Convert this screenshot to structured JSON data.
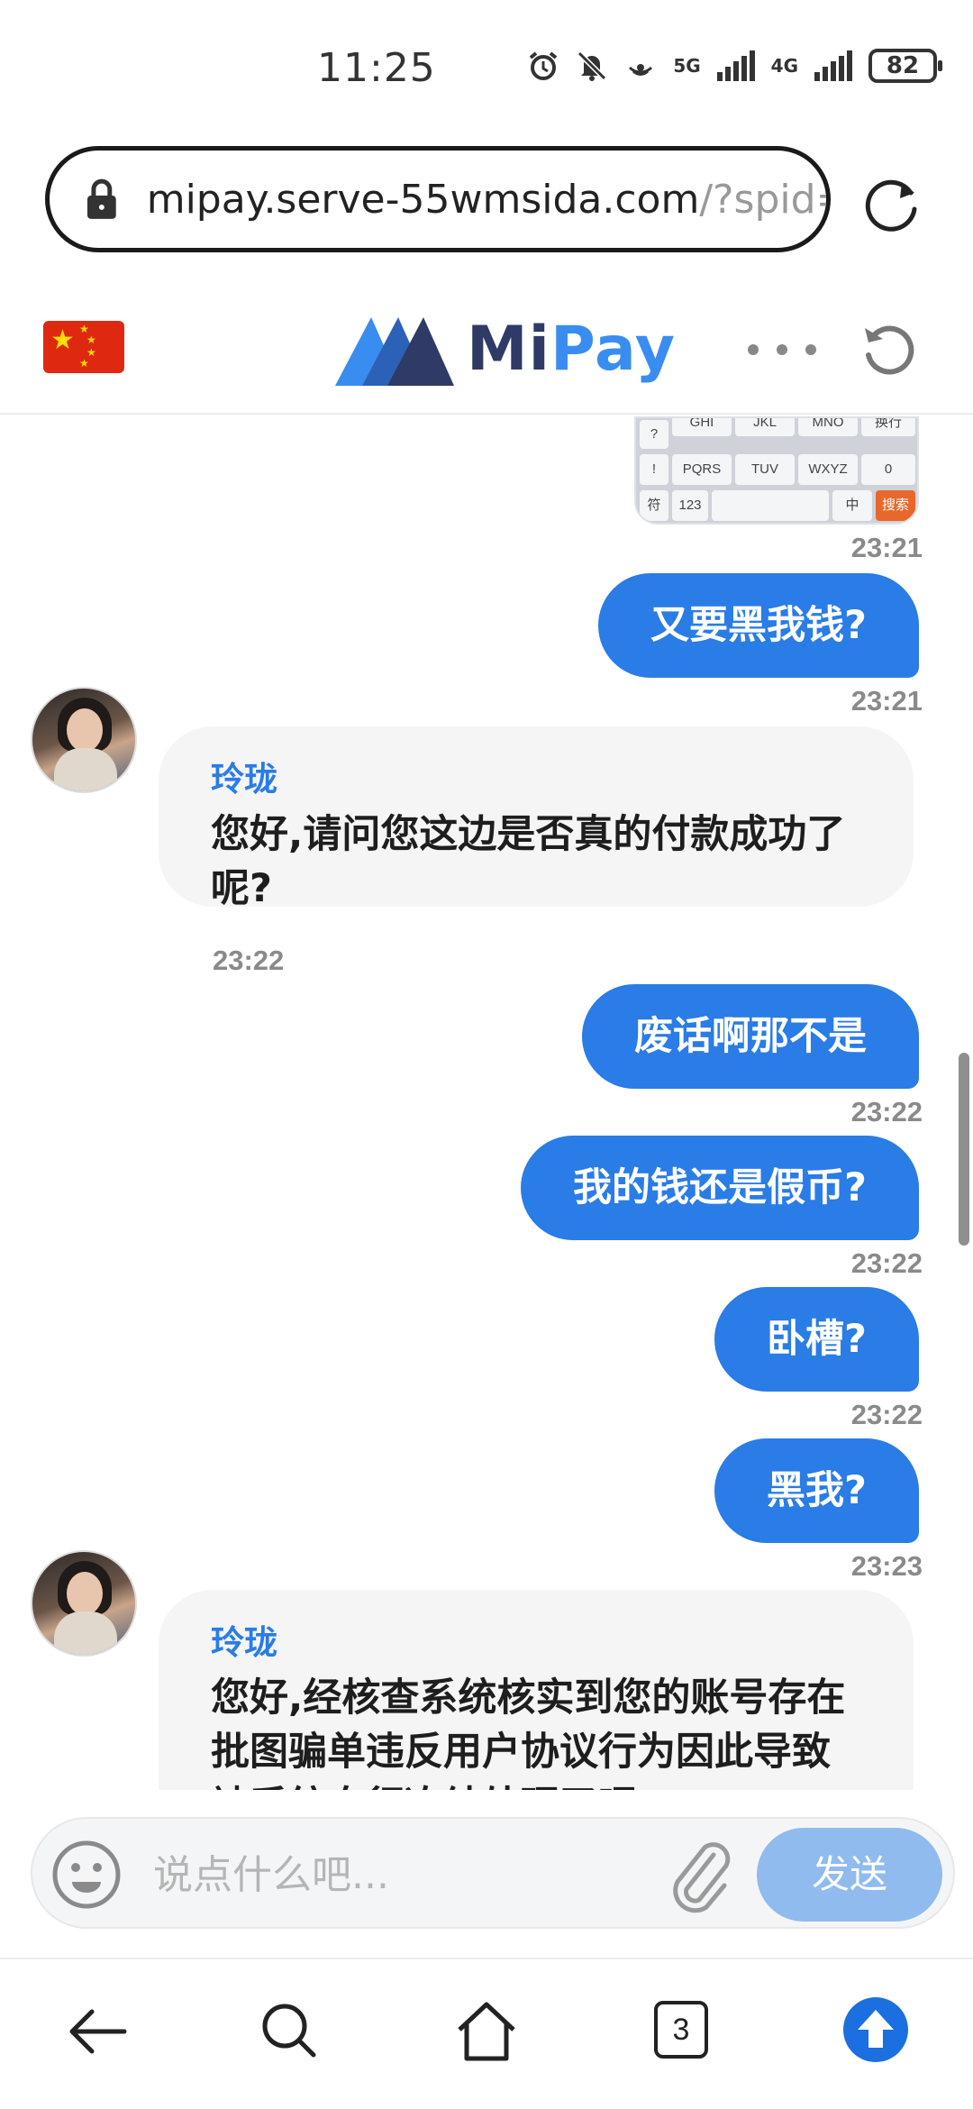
{
  "status_bar": {
    "time": "11:25",
    "network_1": "5G",
    "network_2": "4G",
    "battery": "82",
    "icons": [
      "alarm-icon",
      "mute-icon",
      "hotspot-icon"
    ]
  },
  "browser": {
    "url_main": "mipay.serve-55wmsida.com",
    "url_rest": "/?spid=",
    "nav": {
      "tabs_count": "3"
    }
  },
  "site": {
    "logo_mi": "Mi",
    "logo_pay": "Pay",
    "brand_colors": {
      "dark": "#2f3a66",
      "blue": "#3a8df0"
    }
  },
  "keyboard_preview": {
    "row1": [
      "GHI",
      "JKL",
      "MNO",
      "换行"
    ],
    "row2": [
      "!",
      "PQRS",
      "TUV",
      "WXYZ",
      "0"
    ],
    "row3": [
      "符",
      "123",
      "中",
      "搜索"
    ],
    "left_top": "?"
  },
  "chat": {
    "messages": [
      {
        "side": "out",
        "time": "23:21"
      },
      {
        "side": "out",
        "text": "又要黑我钱?",
        "time": "23:21"
      },
      {
        "side": "in",
        "sender": "玲珑",
        "text": "您好,请问您这边是否真的付款成功了呢?",
        "time": "23:22"
      },
      {
        "side": "out",
        "text": "废话啊那不是",
        "time": "23:22"
      },
      {
        "side": "out",
        "text": "我的钱还是假币?",
        "time": "23:22"
      },
      {
        "side": "out",
        "text": "卧槽?",
        "time": "23:22"
      },
      {
        "side": "out",
        "text": "黑我?",
        "time": "23:23"
      },
      {
        "side": "in",
        "sender": "玲珑",
        "text": "您好,经核查系统核实到您的账号存在批图骗单违反用户协议行为因此导致被系统自行冻结处理了呢"
      }
    ]
  },
  "composer": {
    "placeholder": "说点什么吧...",
    "send_label": "发送"
  },
  "colors": {
    "outgoing_bubble": "#2a7ce6",
    "incoming_bubble": "#f5f5f6",
    "sender_name": "#2a7ce6",
    "send_button": "#8fbbef"
  }
}
